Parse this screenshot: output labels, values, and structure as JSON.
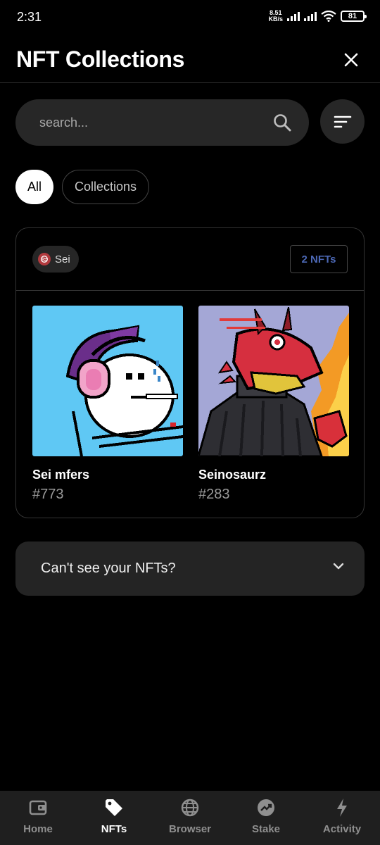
{
  "status_bar": {
    "time": "2:31",
    "net_speed_value": "8.51",
    "net_speed_unit": "KB/s",
    "battery": "81"
  },
  "header": {
    "title": "NFT Collections"
  },
  "search": {
    "placeholder": "search..."
  },
  "filters": {
    "chips": [
      {
        "label": "All",
        "active": true
      },
      {
        "label": "Collections",
        "active": false
      }
    ]
  },
  "collection": {
    "chain_label": "Sei",
    "count_label": "2 NFTs",
    "nfts": [
      {
        "name": "Sei mfers",
        "id": "#773"
      },
      {
        "name": "Seinosaurz",
        "id": "#283"
      }
    ]
  },
  "help": {
    "text": "Can't see your NFTs?"
  },
  "bottom_nav": {
    "items": [
      {
        "label": "Home",
        "icon": "wallet-icon",
        "active": false
      },
      {
        "label": "NFTs",
        "icon": "tag-icon",
        "active": true
      },
      {
        "label": "Browser",
        "icon": "globe-icon",
        "active": false
      },
      {
        "label": "Stake",
        "icon": "stake-chart-icon",
        "active": false
      },
      {
        "label": "Activity",
        "icon": "lightning-icon",
        "active": false
      }
    ]
  },
  "colors": {
    "background": "#000000",
    "surface": "#272727",
    "accent_blue": "#4c68b5",
    "sei_red": "#b23a3e"
  }
}
